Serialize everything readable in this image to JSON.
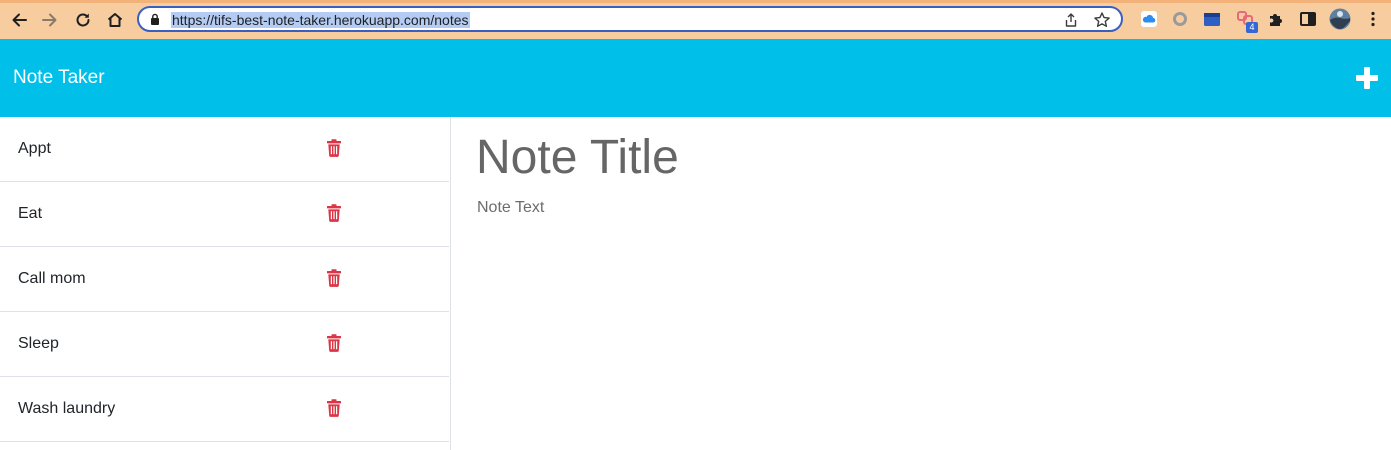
{
  "browser": {
    "url": "https://tifs-best-note-taker.herokuapp.com/notes",
    "extension_badge": "4"
  },
  "app": {
    "brand": "Note Taker",
    "accent_color": "#00c0ea",
    "delete_color": "#dc3545"
  },
  "notes": [
    {
      "title": "Appt"
    },
    {
      "title": "Eat"
    },
    {
      "title": "Call mom"
    },
    {
      "title": "Sleep"
    },
    {
      "title": "Wash laundry"
    }
  ],
  "editor": {
    "title_placeholder": "Note Title",
    "text_placeholder": "Note Text"
  }
}
